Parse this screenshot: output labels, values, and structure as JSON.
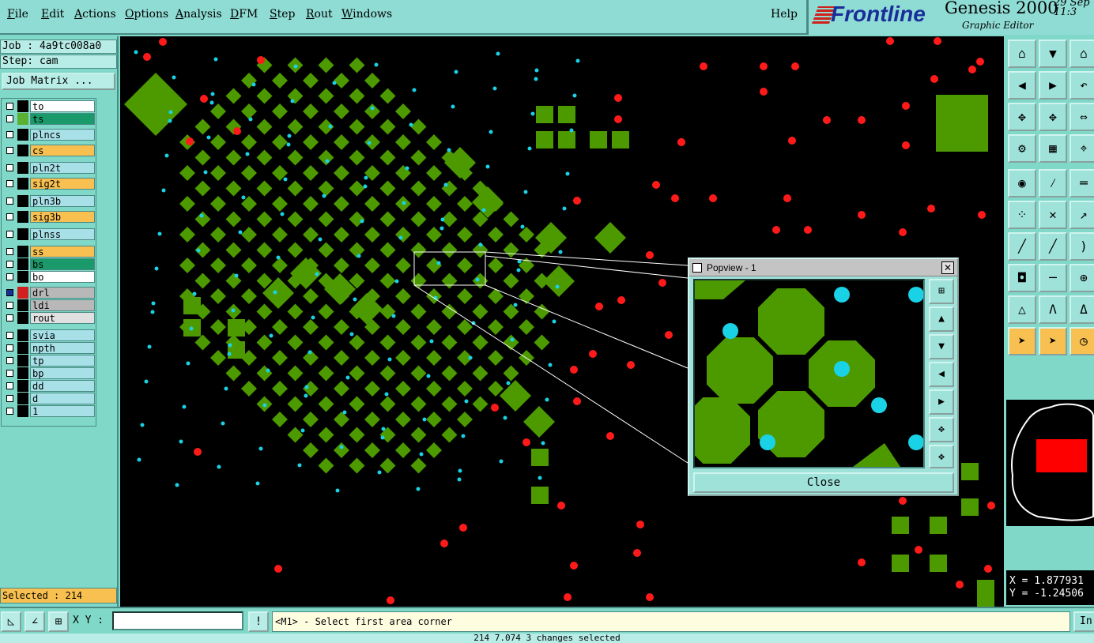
{
  "menu": {
    "items": [
      "File",
      "Edit",
      "Actions",
      "Options",
      "Analysis",
      "DFM",
      "Step",
      "Rout",
      "Windows"
    ],
    "help": "Help"
  },
  "brand": {
    "logo": "Frontline",
    "product": "Genesis 2000",
    "subtitle": "Graphic Editor",
    "date_line1": "29 Sep",
    "date_line2": "11:3"
  },
  "job": {
    "job_label": "Job : 4a9tc008a0",
    "step_label": "Step: cam",
    "matrix_button": "Job Matrix ..."
  },
  "layers": [
    {
      "name": "to",
      "color": "#ffffff",
      "swatch": "#000000"
    },
    {
      "name": "ts",
      "color": "#1a9a6a",
      "swatch": "#5ab030"
    },
    {
      "name": "plncs",
      "color": "#a8e0e8",
      "swatch": "#000000"
    },
    {
      "name": "cs",
      "color": "#f8c050",
      "swatch": "#000000"
    },
    {
      "name": "pln2t",
      "color": "#a8e0e8",
      "swatch": "#000000"
    },
    {
      "name": "sig2t",
      "color": "#f8c050",
      "swatch": "#000000"
    },
    {
      "name": "pln3b",
      "color": "#a8e0e8",
      "swatch": "#000000"
    },
    {
      "name": "sig3b",
      "color": "#f8c050",
      "swatch": "#000000"
    },
    {
      "name": "plnss",
      "color": "#a8e0e8",
      "swatch": "#000000"
    },
    {
      "name": "ss",
      "color": "#f8c050",
      "swatch": "#000000"
    },
    {
      "name": "bs",
      "color": "#1a9a6a",
      "swatch": "#000000"
    },
    {
      "name": "bo",
      "color": "#ffffff",
      "swatch": "#000000"
    },
    {
      "name": "drl",
      "color": "#b8b8b8",
      "swatch": "#d02020"
    },
    {
      "name": "ldi",
      "color": "#b8b8b8",
      "swatch": "#000000"
    },
    {
      "name": "rout",
      "color": "#e0e0e0",
      "swatch": "#000000"
    },
    {
      "name": "svia",
      "color": "#a8e0e8",
      "swatch": "#000000"
    },
    {
      "name": "npth",
      "color": "#a8e0e8",
      "swatch": "#000000"
    },
    {
      "name": "tp",
      "color": "#a8e0e8",
      "swatch": "#000000"
    },
    {
      "name": "bp",
      "color": "#a8e0e8",
      "swatch": "#000000"
    },
    {
      "name": "dd",
      "color": "#a8e0e8",
      "swatch": "#000000"
    },
    {
      "name": "d",
      "color": "#a8e0e8",
      "swatch": "#000000"
    },
    {
      "name": "1",
      "color": "#a8e0e8",
      "swatch": "#000000"
    }
  ],
  "selected_label": "Selected : 214",
  "coords": {
    "x": "X = 1.877931",
    "y": "Y = -1.24506"
  },
  "bottom": {
    "xy_label": "X Y :",
    "xy_value": "",
    "message": "<M1> - Select first area corner",
    "in_button": "In",
    "status": "214 7.074 3 changes selected"
  },
  "popview": {
    "title": "Popview - 1",
    "close_button": "Close"
  },
  "colors": {
    "pad_green": "#4d9a00",
    "drill_red": "#ff1a1a",
    "via_cyan": "#1ad2e6"
  }
}
